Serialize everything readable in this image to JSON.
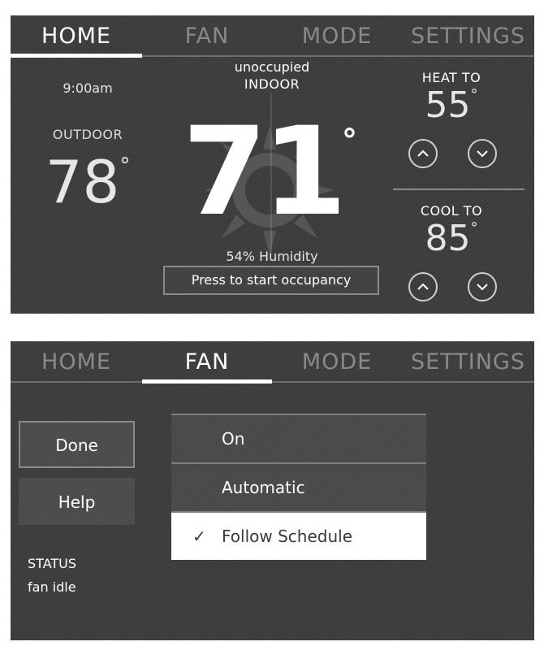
{
  "tabs": [
    {
      "label": "HOME"
    },
    {
      "label": "FAN"
    },
    {
      "label": "MODE"
    },
    {
      "label": "SETTINGS"
    }
  ],
  "home_screen": {
    "active_tab": "HOME",
    "time": "9:00am",
    "outdoor_label": "OUTDOOR",
    "outdoor_temp": "78",
    "occupancy_status": "unoccupied",
    "indoor_label": "INDOOR",
    "indoor_temp": "71",
    "degree_symbol": "°",
    "humidity": "54% Humidity",
    "occupancy_button": "Press to start occupancy",
    "heat_label": "HEAT TO",
    "heat_temp": "55",
    "cool_label": "COOL TO",
    "cool_temp": "85",
    "icons": [
      "chevron-up-icon",
      "chevron-down-icon",
      "sunburst-icon"
    ]
  },
  "fan_screen": {
    "active_tab": "FAN",
    "done_label": "Done",
    "help_label": "Help",
    "status_label": "STATUS",
    "status_value": "fan idle",
    "options": [
      {
        "label": "On",
        "selected": false
      },
      {
        "label": "Automatic",
        "selected": false
      },
      {
        "label": "Follow Schedule",
        "selected": true
      }
    ],
    "check_mark": "✓"
  },
  "colors": {
    "background": "#3c3c3c",
    "inactive_tab": "#8a8a8a",
    "active": "#ffffff",
    "selected_option_text": "#3a3a3a"
  }
}
